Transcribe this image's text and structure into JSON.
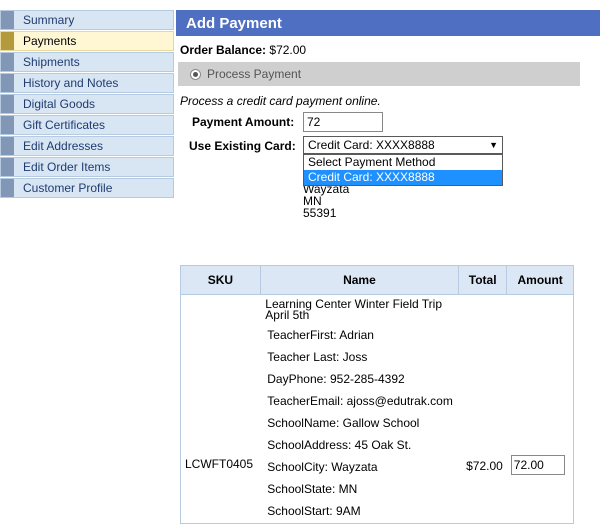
{
  "sidebar": {
    "items": [
      {
        "label": "Summary"
      },
      {
        "label": "Payments"
      },
      {
        "label": "Shipments"
      },
      {
        "label": "History and Notes"
      },
      {
        "label": "Digital Goods"
      },
      {
        "label": "Gift Certificates"
      },
      {
        "label": "Edit Addresses"
      },
      {
        "label": "Edit Order Items"
      },
      {
        "label": "Customer Profile"
      }
    ],
    "active": "Payments"
  },
  "header": {
    "title": "Add Payment"
  },
  "order": {
    "balance_label": "Order Balance:",
    "balance_value": "$72.00"
  },
  "process": {
    "option_label": "Process Payment",
    "description": "Process a credit card payment online."
  },
  "form": {
    "payment_amount_label": "Payment Amount:",
    "payment_amount_value": "72",
    "existing_card_label": "Use Existing Card:",
    "existing_card_selected": "Credit Card: XXXX8888",
    "options": [
      "Select Payment Method",
      "Credit Card: XXXX8888"
    ]
  },
  "address": {
    "city": "Wayzata",
    "state": "MN",
    "zip": "55391"
  },
  "table": {
    "headers": [
      "SKU",
      "Name",
      "Total",
      "Amount"
    ],
    "row": {
      "sku": "LCWFT0405",
      "name_title": "Learning Center Winter Field Trip April 5th",
      "details": [
        "TeacherFirst: Adrian",
        "Teacher Last: Joss",
        "DayPhone: 952-285-4392",
        "TeacherEmail: ajoss@edutrak.com",
        "SchoolName: Gallow School",
        "SchoolAddress: 45 Oak St.",
        "SchoolCity: Wayzata",
        "SchoolState: MN",
        "SchoolStart: 9AM"
      ],
      "total": "$72.00",
      "amount": "72.00"
    }
  }
}
